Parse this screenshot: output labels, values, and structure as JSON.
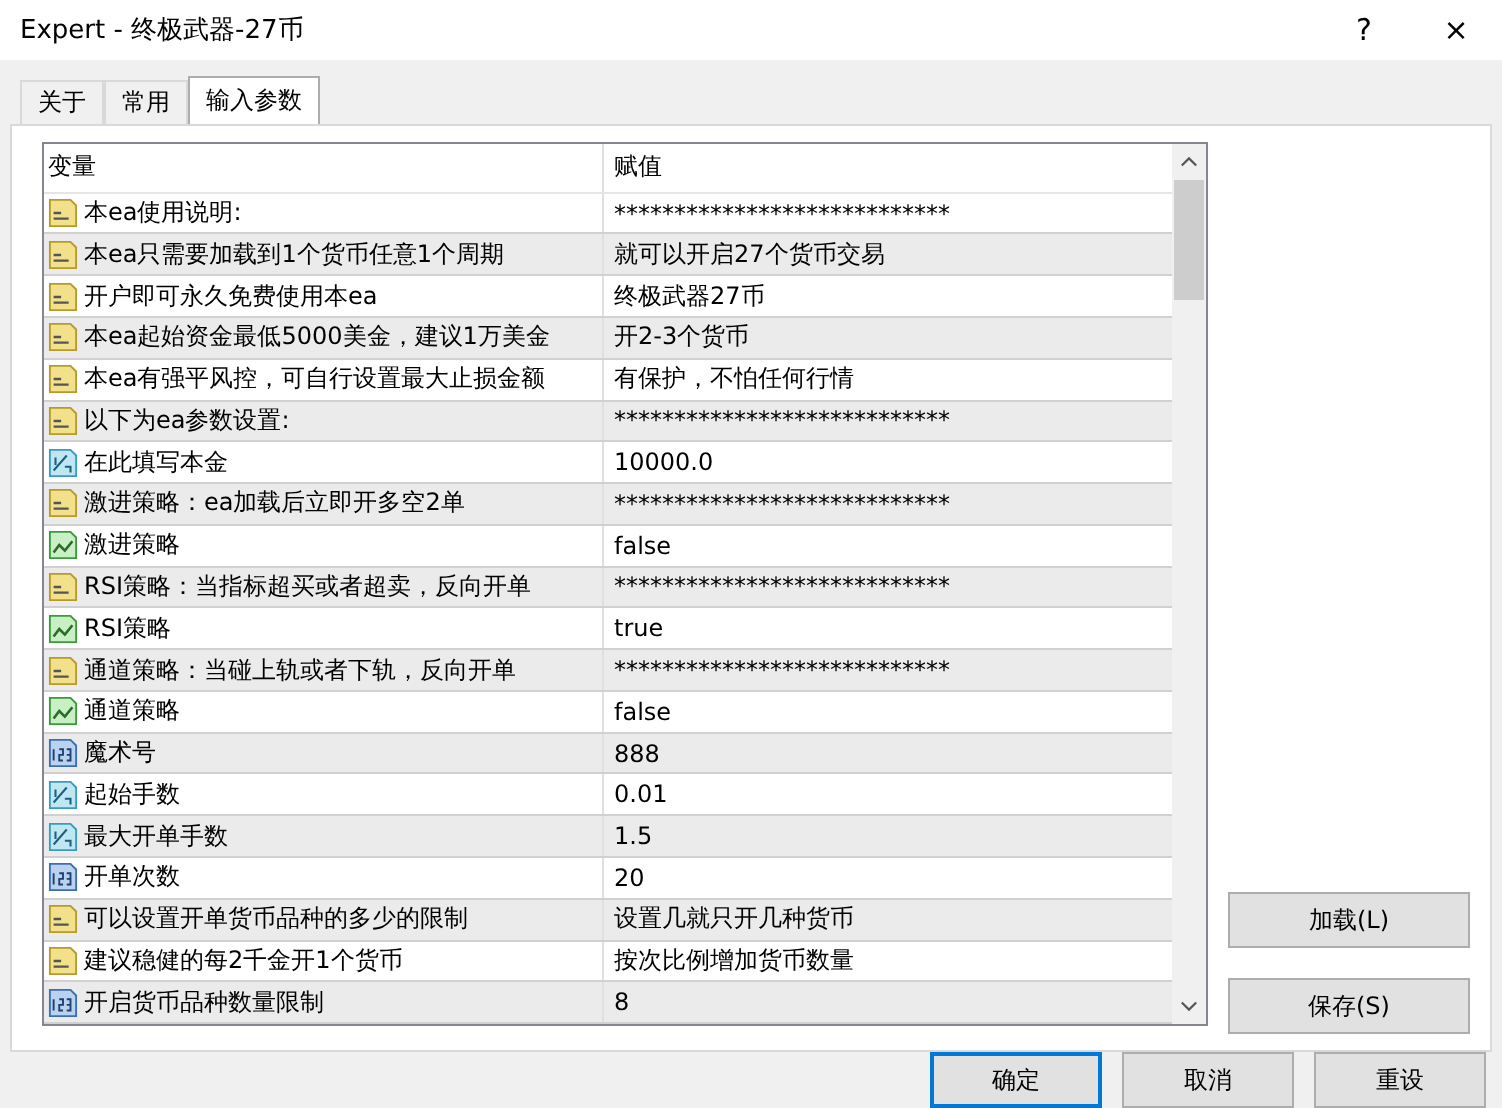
{
  "window": {
    "title": "Expert - 终极武器-27币",
    "help": "?",
    "close": "×"
  },
  "tabs": [
    {
      "label": "关于",
      "selected": false
    },
    {
      "label": "常用",
      "selected": false
    },
    {
      "label": "输入参数",
      "selected": true
    }
  ],
  "table": {
    "columns": [
      "变量",
      "赋值"
    ],
    "rows": [
      {
        "kind": "string",
        "name": "本ea使用说明:",
        "value": "****************************"
      },
      {
        "kind": "string",
        "name": "本ea只需要加载到1个货币任意1个周期",
        "value": "就可以开启27个货币交易"
      },
      {
        "kind": "string",
        "name": "开户即可永久免费使用本ea",
        "value": "终极武器27币"
      },
      {
        "kind": "string",
        "name": "本ea起始资金最低5000美金，建议1万美金",
        "value": "开2-3个货币"
      },
      {
        "kind": "string",
        "name": "本ea有强平风控，可自行设置最大止损金额",
        "value": "有保护，不怕任何行情"
      },
      {
        "kind": "string",
        "name": "以下为ea参数设置:",
        "value": "****************************"
      },
      {
        "kind": "double",
        "name": "在此填写本金",
        "value": "10000.0"
      },
      {
        "kind": "string",
        "name": "激进策略：ea加载后立即开多空2单",
        "value": "****************************"
      },
      {
        "kind": "bool",
        "name": "激进策略",
        "value": "false"
      },
      {
        "kind": "string",
        "name": "RSI策略：当指标超买或者超卖，反向开单",
        "value": "****************************"
      },
      {
        "kind": "bool",
        "name": "RSI策略",
        "value": "true"
      },
      {
        "kind": "string",
        "name": "通道策略：当碰上轨或者下轨，反向开单",
        "value": "****************************"
      },
      {
        "kind": "bool",
        "name": "通道策略",
        "value": "false"
      },
      {
        "kind": "int",
        "name": "魔术号",
        "value": "888"
      },
      {
        "kind": "double",
        "name": "起始手数",
        "value": "0.01"
      },
      {
        "kind": "double",
        "name": "最大开单手数",
        "value": "1.5"
      },
      {
        "kind": "int",
        "name": "开单次数",
        "value": "20"
      },
      {
        "kind": "string",
        "name": "可以设置开单货币品种的多少的限制",
        "value": "设置几就只开几种货币"
      },
      {
        "kind": "string",
        "name": "建议稳健的每2千金开1个货币",
        "value": "按次比例增加货币数量"
      },
      {
        "kind": "int",
        "name": "开启货币品种数量限制",
        "value": "8"
      }
    ]
  },
  "side_buttons": [
    "加载(L)",
    "保存(S)"
  ],
  "footer_buttons": [
    {
      "label": "确定",
      "selected": true
    },
    {
      "label": "取消",
      "selected": false
    },
    {
      "label": "重设",
      "selected": false
    }
  ]
}
